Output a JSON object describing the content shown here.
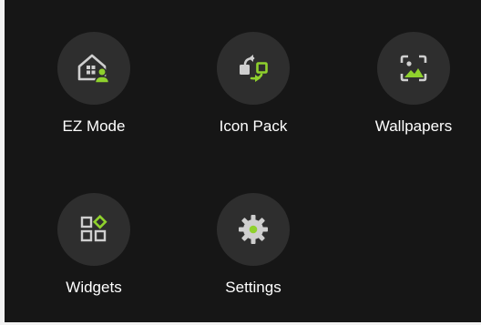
{
  "colors": {
    "background": "#161616",
    "circle": "#2e2e2e",
    "icon_gray": "#cfcfcf",
    "accent_green": "#8fd12d",
    "label": "#ffffff"
  },
  "menu": {
    "items": [
      {
        "label": "EZ Mode",
        "icon": "house-user-icon"
      },
      {
        "label": "Icon Pack",
        "icon": "icon-swap-icon"
      },
      {
        "label": "Wallpapers",
        "icon": "wallpaper-image-icon"
      },
      {
        "label": "Widgets",
        "icon": "widgets-grid-icon"
      },
      {
        "label": "Settings",
        "icon": "gear-icon"
      }
    ]
  }
}
